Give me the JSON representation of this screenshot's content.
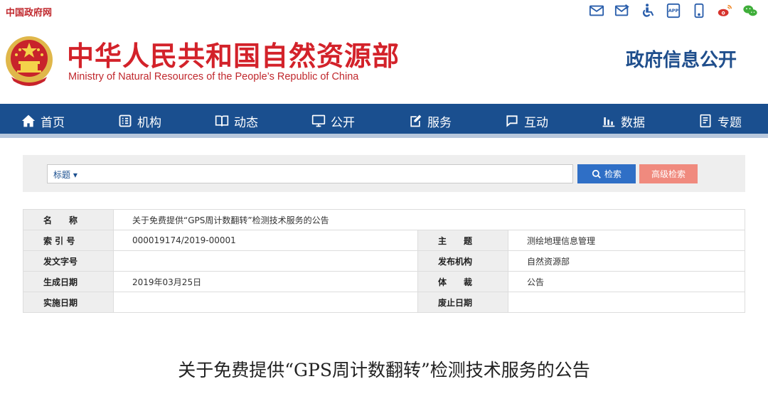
{
  "topbar": {
    "gov_link": "中国政府网",
    "icons": [
      "mail-icon",
      "mail-forward-icon",
      "accessibility-icon",
      "app-icon",
      "mobile-icon",
      "weibo-icon",
      "wechat-icon"
    ]
  },
  "header": {
    "title": "中华人民共和国自然资源部",
    "subtitle": "Ministry of Natural Resources of the People’s Republic of China",
    "section": "政府信息公开"
  },
  "nav": {
    "items": [
      {
        "label": "首页",
        "icon": "home-icon"
      },
      {
        "label": "机构",
        "icon": "org-icon"
      },
      {
        "label": "动态",
        "icon": "book-icon"
      },
      {
        "label": "公开",
        "icon": "monitor-icon"
      },
      {
        "label": "服务",
        "icon": "edit-icon"
      },
      {
        "label": "互动",
        "icon": "chat-icon"
      },
      {
        "label": "数据",
        "icon": "bar-chart-icon"
      },
      {
        "label": "专题",
        "icon": "document-icon"
      }
    ]
  },
  "search": {
    "type_label": "标题",
    "placeholder": "",
    "search_button": "检索",
    "advanced_button": "高级检索"
  },
  "info": {
    "name_label": "名　　称",
    "name_value": "关于免费提供“GPS周计数翻转”检测技术服务的公告",
    "index_label": "索 引 号",
    "index_value": "000019174/2019-00001",
    "subject_label": "主　　题",
    "subject_value": "测绘地理信息管理",
    "doc_no_label": "发文字号",
    "doc_no_value": "",
    "publisher_label": "发布机构",
    "publisher_value": "自然资源部",
    "created_label": "生成日期",
    "created_value": "2019年03月25日",
    "genre_label": "体　　裁",
    "genre_value": "公告",
    "effective_label": "实施日期",
    "effective_value": "",
    "expire_label": "废止日期",
    "expire_value": ""
  },
  "article": {
    "title": "关于免费提供“GPS周计数翻转”检测技术服务的公告"
  },
  "colors": {
    "brand_red": "#d3222a",
    "nav_blue": "#1a4f8f",
    "search_blue": "#2f6fc6",
    "adv_salmon": "#f08a7e"
  }
}
